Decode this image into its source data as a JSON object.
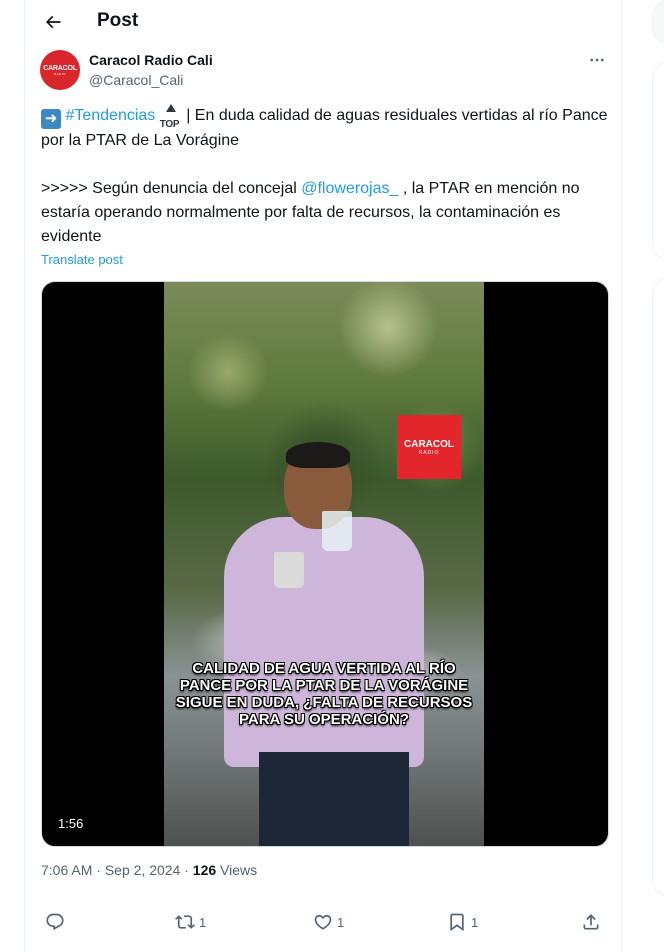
{
  "header": {
    "title": "Post"
  },
  "author": {
    "name": "Caracol Radio Cali",
    "handle": "@Caracol_Cali",
    "avatar_text": "CARACOL",
    "avatar_sub": "RADIO"
  },
  "post": {
    "line1_hashtag": "#Tendencias",
    "line1_emoji_top": "TOP",
    "line1_text": " | En duda calidad de aguas residuales vertidas al río Pance por la PTAR de La Vorágine",
    "line2_prefix": ">>>>> Según denuncia del concejal ",
    "line2_mention": "@flowerojas_",
    "line2_suffix": " , la PTAR en mención no estaría operando normalmente por falta de recursos, la contaminación es evidente",
    "translate_label": "Translate post"
  },
  "media": {
    "logo_text": "CARACOL",
    "logo_sub": "RADIO",
    "caption": "CALIDAD DE AGUA VERTIDA AL RÍO PANCE POR LA PTAR DE LA VORÁGINE SIGUE EN DUDA, ¿FALTA DE RECURSOS PARA SU OPERACIÓN?",
    "duration": "1:56"
  },
  "meta": {
    "time": "7:06 AM",
    "separator": " · ",
    "date": "Sep 2, 2024",
    "views_count": "126",
    "views_label": " Views"
  },
  "actions": {
    "replies": "",
    "reposts": "1",
    "likes": "1",
    "bookmarks": "1"
  },
  "icons": [
    "back-arrow-icon",
    "more-icon",
    "reply-icon",
    "repost-icon",
    "like-icon",
    "bookmark-icon",
    "share-icon",
    "arrow-right-emoji-icon",
    "top-arrow-emoji-icon"
  ],
  "colors": {
    "accent": "#1d9bf0",
    "secondary_text": "#536471",
    "brand_red": "#d9262b"
  }
}
